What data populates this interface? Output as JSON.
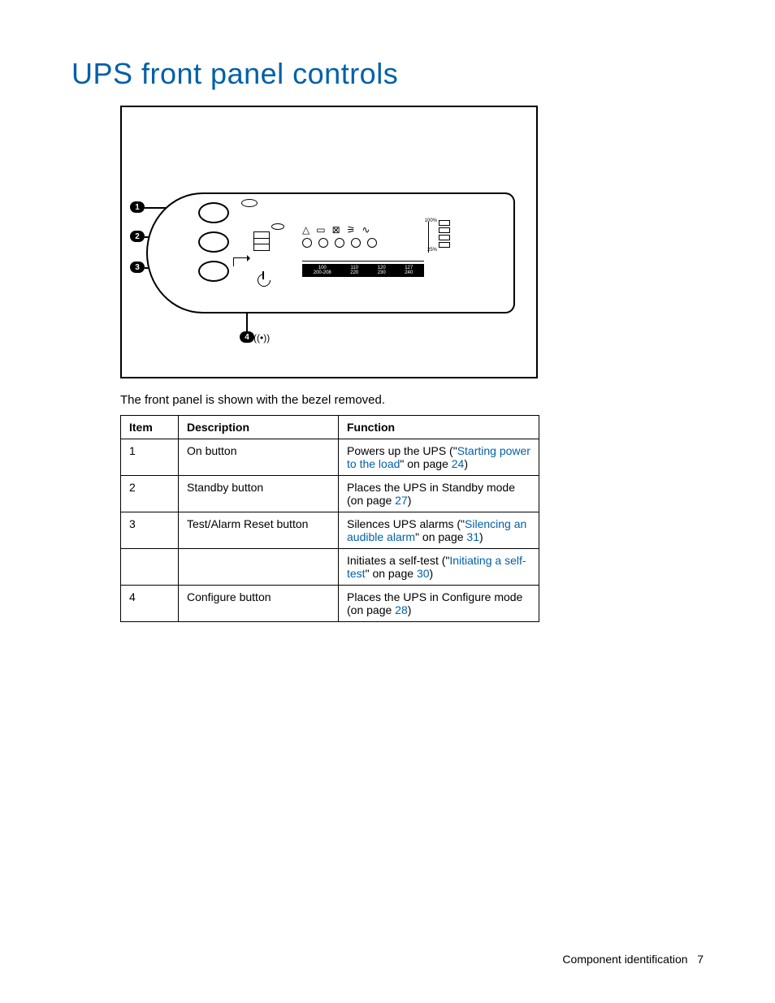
{
  "title": "UPS front panel controls",
  "caption": "The front panel is shown with the bezel removed.",
  "callouts": {
    "c1": "1",
    "c2": "2",
    "c3": "3",
    "c4": "4"
  },
  "lcd": {
    "p100": "100%",
    "p25": "25%",
    "voltages": {
      "v1a": "100",
      "v1b": "200-208",
      "v2a": "110",
      "v2b": "220",
      "v3a": "120",
      "v3b": "230",
      "v4a": "127",
      "v4b": "240"
    }
  },
  "table": {
    "headers": {
      "item": "Item",
      "description": "Description",
      "function": "Function"
    },
    "rows": [
      {
        "item": "1",
        "description": "On button",
        "func_pre": "Powers up the UPS (\"",
        "func_link": "Starting power to the load",
        "func_mid": "\" on page ",
        "func_page": "24",
        "func_post": ")"
      },
      {
        "item": "2",
        "description": "Standby button",
        "func_pre": "Places the UPS in Standby mode (on page ",
        "func_link": "",
        "func_mid": "",
        "func_page": "27",
        "func_post": ")"
      },
      {
        "item": "3",
        "description": "Test/Alarm Reset button",
        "func_pre": "Silences UPS alarms (\"",
        "func_link": "Silencing an audible alarm",
        "func_mid": "\" on page ",
        "func_page": "31",
        "func_post": ")"
      },
      {
        "item": "",
        "description": "",
        "func_pre": "Initiates a self-test (\"",
        "func_link": "Initiating a self-test",
        "func_mid": "\" on page ",
        "func_page": "30",
        "func_post": ")"
      },
      {
        "item": "4",
        "description": "Configure button",
        "func_pre": "Places the UPS in Configure mode (on page ",
        "func_link": "",
        "func_mid": "",
        "func_page": "28",
        "func_post": ")"
      }
    ]
  },
  "footer": {
    "section": "Component identification",
    "page": "7"
  }
}
